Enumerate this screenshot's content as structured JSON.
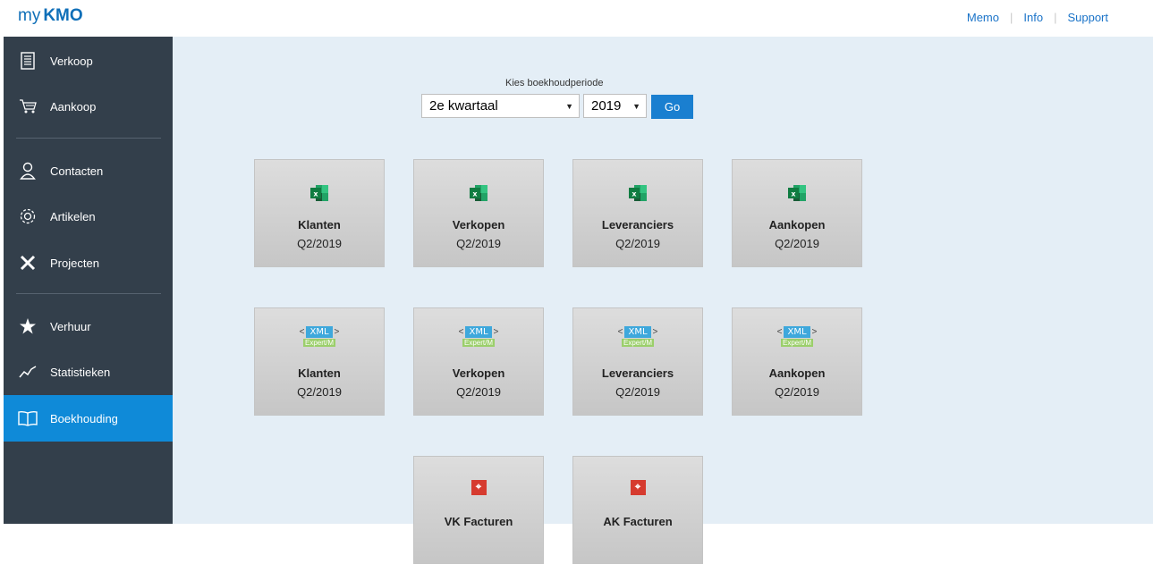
{
  "header": {
    "logo_prefix": "my",
    "logo_brand": "KMO",
    "links": [
      {
        "label": "Memo"
      },
      {
        "label": "Info"
      },
      {
        "label": "Support"
      }
    ]
  },
  "sidebar": {
    "items": [
      {
        "label": "Verkoop",
        "icon": "document-icon"
      },
      {
        "label": "Aankoop",
        "icon": "cart-icon"
      },
      {
        "label": "Contacten",
        "icon": "person-icon"
      },
      {
        "label": "Artikelen",
        "icon": "gear-icon"
      },
      {
        "label": "Projecten",
        "icon": "tools-icon"
      },
      {
        "label": "Verhuur",
        "icon": "star-icon"
      },
      {
        "label": "Statistieken",
        "icon": "line-chart-icon"
      },
      {
        "label": "Boekhouding",
        "icon": "book-icon",
        "active": true
      }
    ]
  },
  "period": {
    "label": "Kies boekhoudperiode",
    "quarter": "2e kwartaal",
    "year": "2019",
    "go_label": "Go"
  },
  "tiles": {
    "excel": [
      {
        "title": "Klanten",
        "sub": "Q2/2019"
      },
      {
        "title": "Verkopen",
        "sub": "Q2/2019"
      },
      {
        "title": "Leveranciers",
        "sub": "Q2/2019"
      },
      {
        "title": "Aankopen",
        "sub": "Q2/2019"
      }
    ],
    "xml": [
      {
        "title": "Klanten",
        "sub": "Q2/2019"
      },
      {
        "title": "Verkopen",
        "sub": "Q2/2019"
      },
      {
        "title": "Leveranciers",
        "sub": "Q2/2019"
      },
      {
        "title": "Aankopen",
        "sub": "Q2/2019"
      }
    ],
    "xml_badge": "XML",
    "xml_lt": "<",
    "xml_gt": ">",
    "xml_sub": "Expert/M",
    "pdf": [
      {
        "title": "VK Facturen"
      },
      {
        "title": "AK Facturen"
      }
    ]
  },
  "colors": {
    "sidebar_bg": "#333f4b",
    "active": "#0f8ad8",
    "main_bg": "#e4eef6",
    "brand": "#0f6fb8",
    "excel_green": "#1e7b45",
    "pdf_red": "#d63b2f"
  }
}
